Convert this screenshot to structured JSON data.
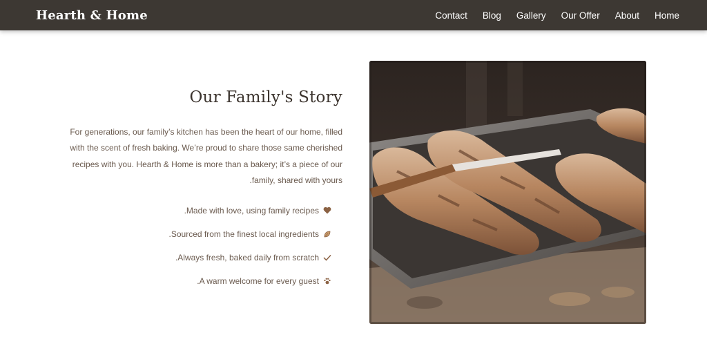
{
  "nav": {
    "brand": "Hearth & Home",
    "links": [
      "Contact",
      "Blog",
      "Gallery",
      "Our Offer",
      "About",
      "Home"
    ]
  },
  "story": {
    "title": "Our Family's Story",
    "body": "For generations, our family’s kitchen has been the heart of our home, filled with the scent of fresh baking. We’re proud to share those same cherished recipes with you. Hearth & Home is more than a bakery; it’s a piece of our family, shared with yours.",
    "features": [
      {
        "icon": "heart-icon",
        "text": "Made with love, using family recipes."
      },
      {
        "icon": "leaf-icon",
        "text": "Sourced from the finest local ingredients."
      },
      {
        "icon": "check-icon",
        "text": "Always fresh, baked daily from scratch."
      },
      {
        "icon": "paw-icon",
        "text": "A warm welcome for every guest."
      }
    ]
  },
  "colors": {
    "navbar": "#3d3833",
    "accent": "#8b6244",
    "title": "#3b332d"
  }
}
